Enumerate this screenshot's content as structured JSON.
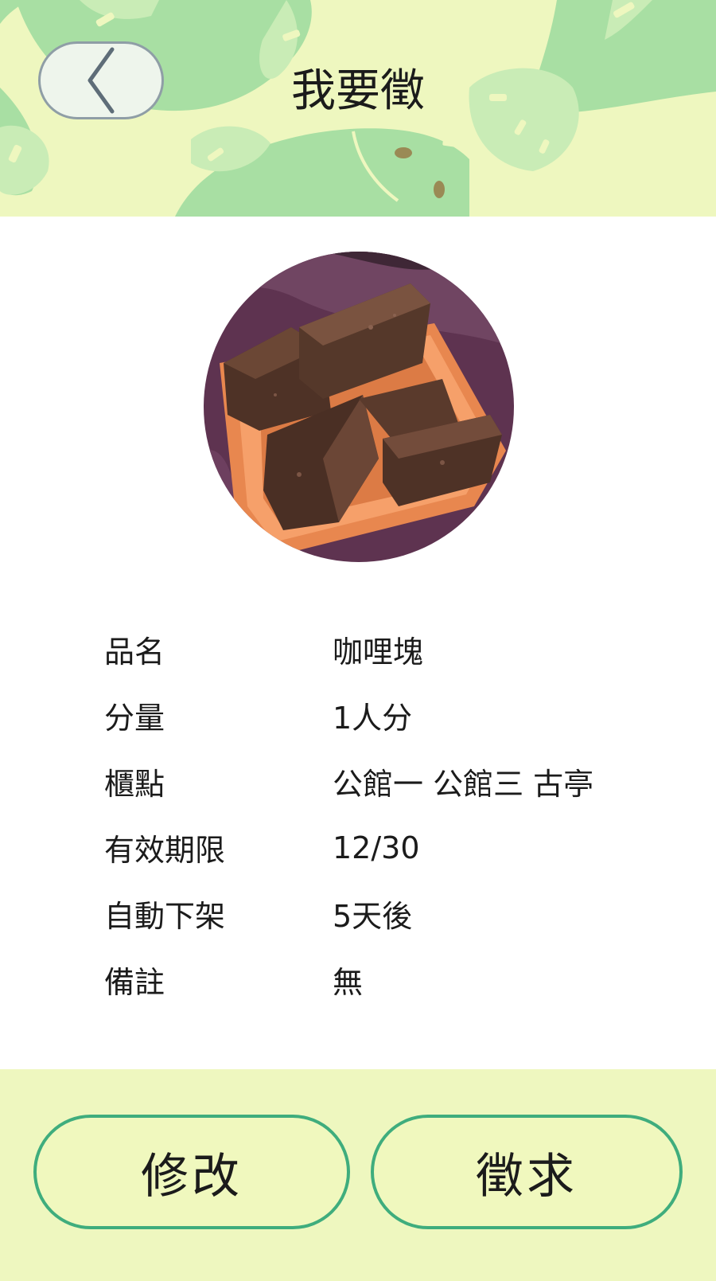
{
  "header": {
    "title": "我要徵"
  },
  "photo": {
    "subject": "brown sugar cubes in an orange tray"
  },
  "details": [
    {
      "label": "品名",
      "value": "咖哩塊"
    },
    {
      "label": "分量",
      "value": "1人分"
    },
    {
      "label": "櫃點",
      "value": "公館一 公館三 古亭"
    },
    {
      "label": "有效期限",
      "value": "12/30"
    },
    {
      "label": "自動下架",
      "value": "5天後"
    },
    {
      "label": "備註",
      "value": "無"
    }
  ],
  "actions": {
    "edit_label": "修改",
    "request_label": "徵求"
  },
  "colors": {
    "header_bg": "#eef7bf",
    "leaf_green": "#a8dfa3",
    "button_border": "#3fad7d",
    "footer_bg": "#eef7bf"
  }
}
